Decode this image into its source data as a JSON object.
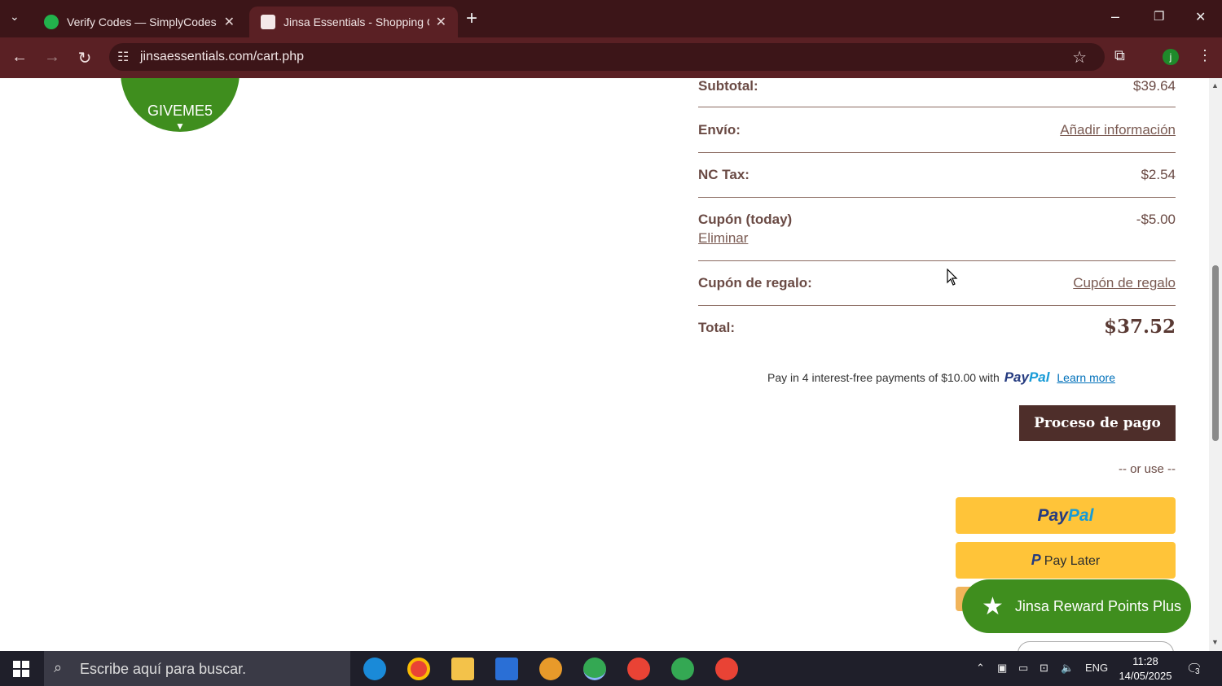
{
  "browser": {
    "tabs": [
      {
        "title": "Verify Codes — SimplyCodes",
        "close": "✕"
      },
      {
        "title": "Jinsa Essentials - Shopping Cart",
        "close": "✕"
      }
    ],
    "new_tab": "+",
    "url": "jinsaessentials.com/cart.php",
    "profile_initial": "j",
    "window_controls": [
      "–",
      "❐",
      "✕"
    ]
  },
  "page": {
    "coupon_badge": {
      "code": "GIVEME5"
    },
    "summary": {
      "subtotal": {
        "label": "Subtotal:",
        "value": "$39.64"
      },
      "shipping": {
        "label": "Envío:",
        "value": "Añadir información"
      },
      "tax": {
        "label": "NC Tax:",
        "value": "$2.54"
      },
      "coupon": {
        "label": "Cupón (today)",
        "value": "-$5.00",
        "remove": "Eliminar"
      },
      "gift": {
        "label": "Cupón de regalo:",
        "value": "Cupón de regalo"
      },
      "total": {
        "label": "Total:",
        "value": "$37.52"
      }
    },
    "paypal_message": {
      "text": "Pay in 4 interest-free payments of $10.00 with",
      "brand_1": "Pay",
      "brand_2": "Pal",
      "learn_more": "Learn more"
    },
    "checkout_button": "Proceso de pago",
    "or_use": "-- or use --",
    "paypal_button": {
      "brand_1": "Pay",
      "brand_2": "Pal"
    },
    "paylater_button": {
      "icon": "P",
      "label": "Pay Later"
    },
    "reward_pill": {
      "label": "Jinsa Reward Points Plus"
    }
  },
  "taskbar": {
    "search_placeholder": "Escribe aquí para buscar.",
    "language": "ENG",
    "time": "11:28",
    "date": "14/05/2025",
    "notification_count": "3"
  },
  "colors": {
    "chrome_dark": "#3c1518",
    "chrome": "#5a2024",
    "brand_green": "#3f8e1e",
    "checkout_brown": "#4e2e2a",
    "paypal_yellow": "#ffc439"
  }
}
